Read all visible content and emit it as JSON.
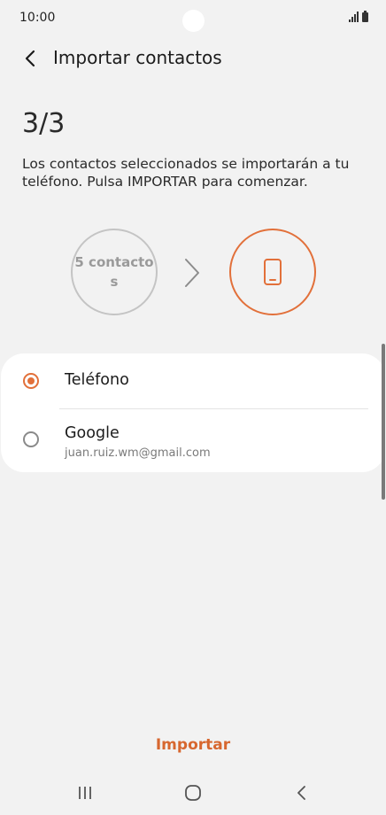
{
  "status_bar": {
    "time": "10:00"
  },
  "app_bar": {
    "title": "Importar contactos"
  },
  "step": {
    "indicator": "3/3",
    "instruction": "Los contactos seleccionados se importarán a tu teléfono. Pulsa IMPORTAR para comenzar."
  },
  "flow": {
    "source_label": "5 contactos",
    "target_icon": "phone-icon"
  },
  "options": [
    {
      "label": "Teléfono",
      "sublabel": "",
      "selected": true
    },
    {
      "label": "Google",
      "sublabel": "juan.ruiz.wm@gmail.com",
      "selected": false
    }
  ],
  "actions": {
    "import_label": "Importar"
  },
  "colors": {
    "accent": "#e2703a",
    "background": "#f2f2f2",
    "card": "#ffffff"
  }
}
